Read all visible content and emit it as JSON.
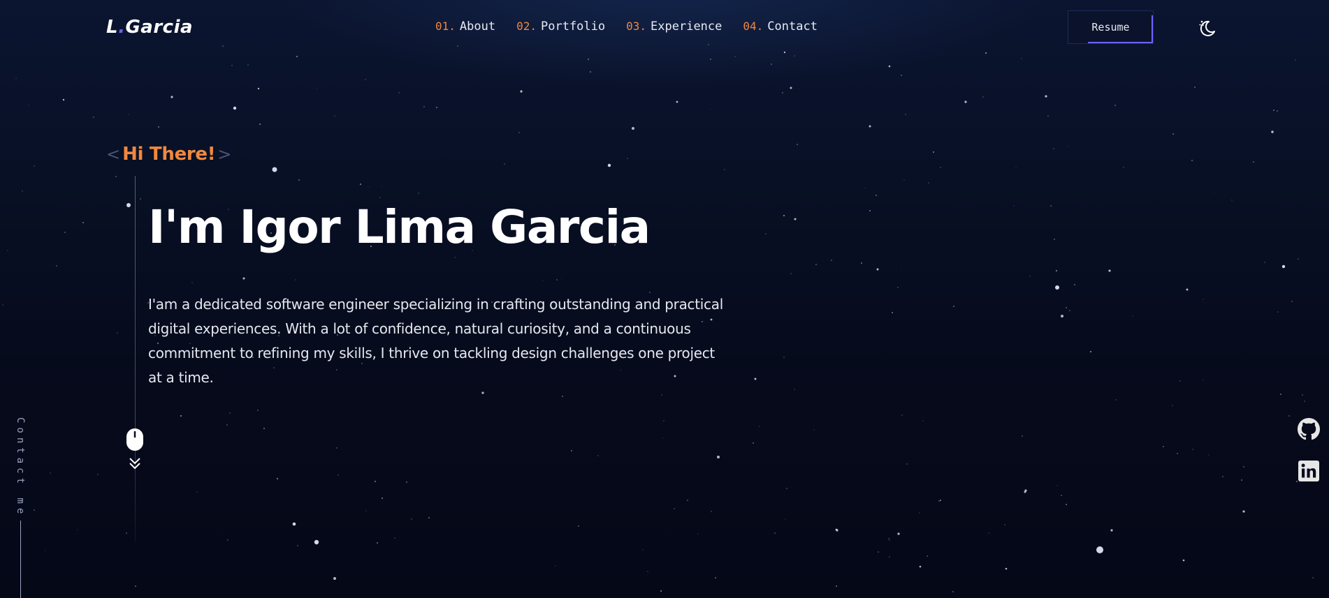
{
  "header": {
    "logo": {
      "letter": "L",
      "dot": ".",
      "name": "Garcia"
    },
    "nav": [
      {
        "num": "01.",
        "label": "About"
      },
      {
        "num": "02.",
        "label": "Portfolio"
      },
      {
        "num": "03.",
        "label": "Experience"
      },
      {
        "num": "04.",
        "label": "Contact"
      }
    ],
    "resume_label": "Resume",
    "theme_toggle_icon": "moon-stars-icon"
  },
  "hero": {
    "bracket_open": "<",
    "greeting": "Hi There!",
    "bracket_close": ">",
    "headline": "I'm Igor Lima Garcia",
    "description": "I'am a dedicated software engineer specializing in crafting outstanding and practical digital experiences. With a lot of confidence, natural curiosity, and a continuous commitment to refining my skills, I thrive on tackling design challenges one project at a time.",
    "scroll_icons": [
      "mouse-icon",
      "chevrons-down-icon"
    ]
  },
  "sidebar_left": {
    "contact_label": "Contact me"
  },
  "socials": [
    {
      "icon": "github-icon"
    },
    {
      "icon": "linkedin-icon"
    }
  ],
  "colors": {
    "background": "#070b1c",
    "accent_orange": "#f0883e",
    "accent_purple": "#6c63ff",
    "text": "#ffffff",
    "muted": "#9aa2c0"
  }
}
